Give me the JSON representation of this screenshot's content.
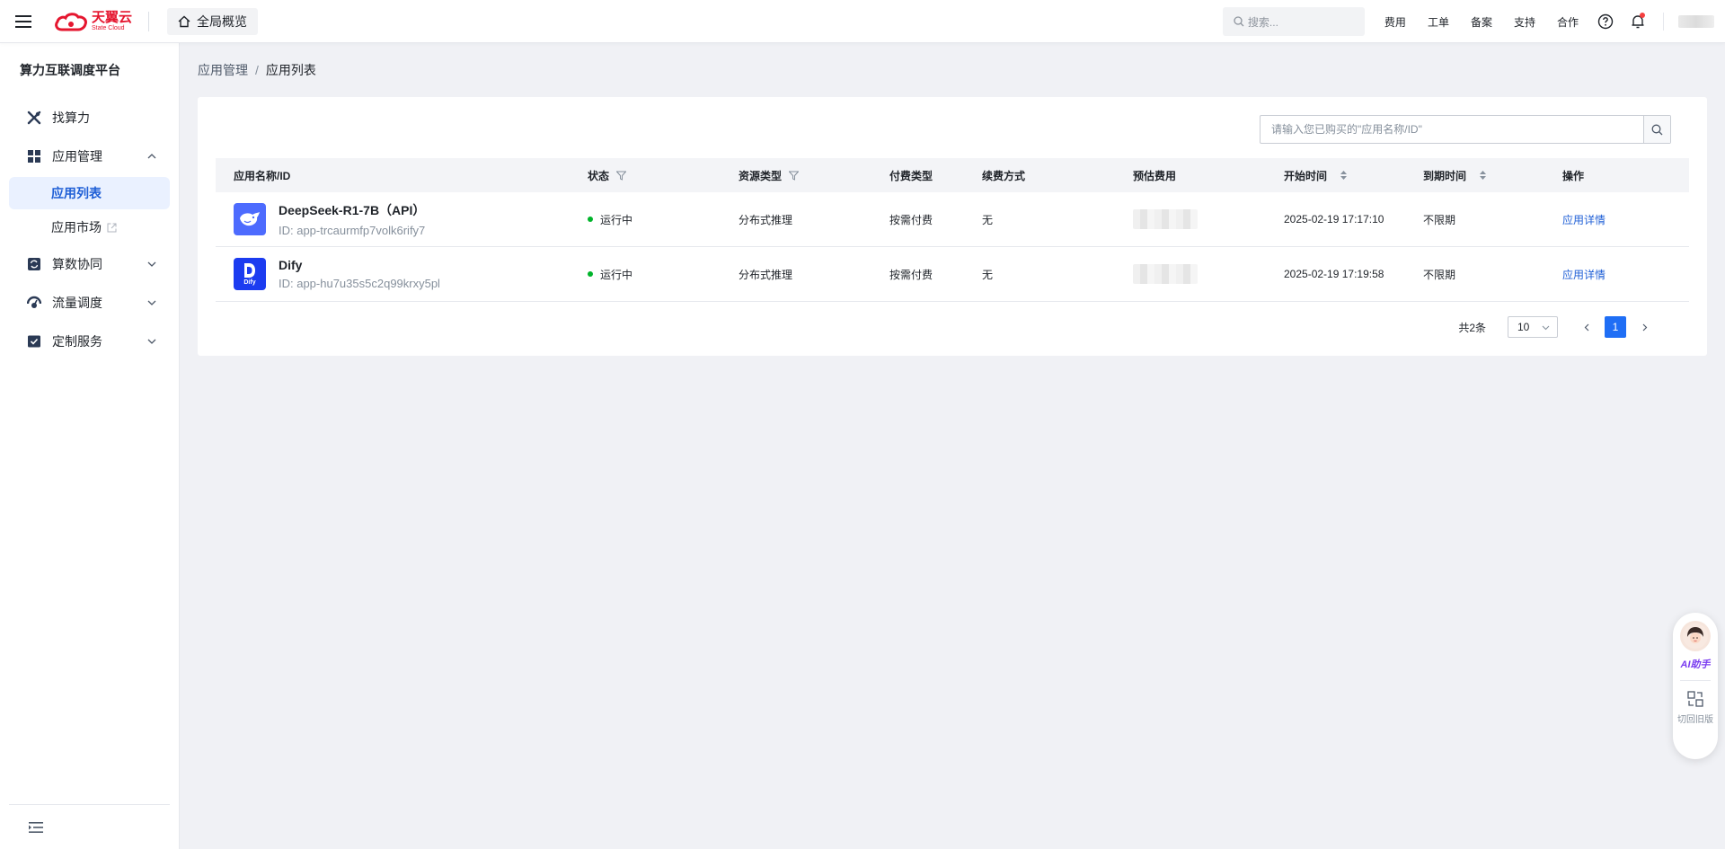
{
  "brand": {
    "name_cn": "天翼云",
    "name_en": "State Cloud",
    "color": "#e5162f"
  },
  "topbar": {
    "home_tab": "全局概览",
    "search_placeholder": "搜索...",
    "links": [
      "费用",
      "工单",
      "备案",
      "支持",
      "合作"
    ]
  },
  "sidebar": {
    "title": "算力互联调度平台",
    "items": [
      {
        "label": "找算力",
        "icon": "compute-icon"
      },
      {
        "label": "应用管理",
        "icon": "grid-icon",
        "expanded": true,
        "children": [
          {
            "label": "应用列表",
            "active": true
          },
          {
            "label": "应用市场",
            "external": true
          }
        ]
      },
      {
        "label": "算数协同",
        "icon": "sync-icon"
      },
      {
        "label": "流量调度",
        "icon": "traffic-icon"
      },
      {
        "label": "定制服务",
        "icon": "check-box-icon"
      }
    ]
  },
  "breadcrumb": {
    "parent": "应用管理",
    "sep": "/",
    "current": "应用列表"
  },
  "list": {
    "search_placeholder": "请输入您已购买的\"应用名称/ID\"",
    "columns": [
      "应用名称/ID",
      "状态",
      "资源类型",
      "付费类型",
      "续费方式",
      "预估费用",
      "开始时间",
      "到期时间",
      "操作"
    ],
    "rows": [
      {
        "name": "DeepSeek-R1-7B（API）",
        "id": "ID: app-trcaurmfp7volk6rify7",
        "status": "运行中",
        "resource": "分布式推理",
        "pay": "按需付费",
        "renew": "无",
        "start": "2025-02-19 17:17:10",
        "expire": "不限期",
        "action": "应用详情",
        "logo": "deepseek-logo",
        "logo_color": "#4d6bfe"
      },
      {
        "name": "Dify",
        "id": "ID: app-hu7u35s5c2q99krxy5pl",
        "status": "运行中",
        "resource": "分布式推理",
        "pay": "按需付费",
        "renew": "无",
        "start": "2025-02-19 17:19:58",
        "expire": "不限期",
        "action": "应用详情",
        "logo": "dify-logo",
        "logo_color": "#1c3cf0",
        "logo_text": "Dify"
      }
    ]
  },
  "pagination": {
    "total": "共2条",
    "page_size": "10",
    "current": "1"
  },
  "float": {
    "ai_label": "AI助手",
    "switch_label": "切回旧版"
  },
  "colors": {
    "accent": "#1f6ef5",
    "link": "#1f5fd6",
    "status_running": "#00b42a"
  }
}
